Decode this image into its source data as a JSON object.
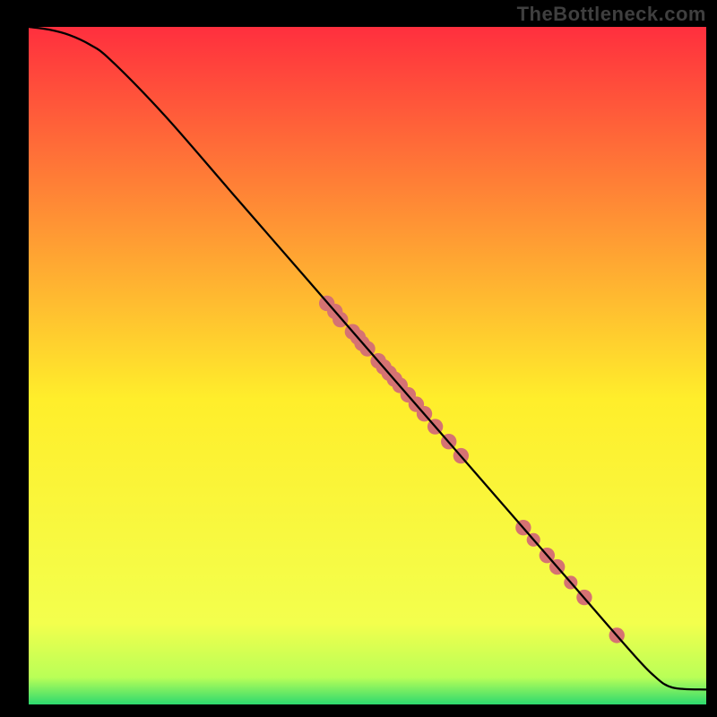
{
  "watermark": "TheBottleneck.com",
  "chart_data": {
    "type": "line",
    "title": "",
    "xlabel": "",
    "ylabel": "",
    "xlim": [
      0,
      100
    ],
    "ylim": [
      0,
      100
    ],
    "series": [
      {
        "name": "curve",
        "x": [
          0,
          3,
          6,
          9,
          12,
          20,
          30,
          40,
          50,
          60,
          70,
          80,
          88,
          92,
          95,
          100
        ],
        "y": [
          100,
          99.6,
          98.8,
          97.4,
          95.2,
          87,
          75.5,
          64,
          52.5,
          41,
          29.5,
          18,
          8.8,
          4.5,
          2.5,
          2.2
        ]
      }
    ],
    "markers": [
      {
        "x": 44.0,
        "y": 59.2,
        "r": 1.15
      },
      {
        "x": 45.2,
        "y": 58.0,
        "r": 1.15
      },
      {
        "x": 46.0,
        "y": 56.8,
        "r": 1.15
      },
      {
        "x": 47.8,
        "y": 55.0,
        "r": 1.15
      },
      {
        "x": 48.6,
        "y": 54.2,
        "r": 1.15
      },
      {
        "x": 49.2,
        "y": 53.3,
        "r": 1.15
      },
      {
        "x": 50.0,
        "y": 52.5,
        "r": 1.15
      },
      {
        "x": 51.6,
        "y": 50.7,
        "r": 1.15
      },
      {
        "x": 52.4,
        "y": 49.8,
        "r": 1.15
      },
      {
        "x": 53.2,
        "y": 48.9,
        "r": 1.15
      },
      {
        "x": 54.0,
        "y": 48.0,
        "r": 1.15
      },
      {
        "x": 54.8,
        "y": 47.1,
        "r": 1.15
      },
      {
        "x": 56.0,
        "y": 45.7,
        "r": 1.15
      },
      {
        "x": 57.2,
        "y": 44.3,
        "r": 1.15
      },
      {
        "x": 58.4,
        "y": 42.9,
        "r": 1.15
      },
      {
        "x": 60.0,
        "y": 41.0,
        "r": 1.15
      },
      {
        "x": 62.0,
        "y": 38.8,
        "r": 1.15
      },
      {
        "x": 63.8,
        "y": 36.7,
        "r": 1.15
      },
      {
        "x": 73.0,
        "y": 26.1,
        "r": 1.15
      },
      {
        "x": 74.5,
        "y": 24.3,
        "r": 1.0
      },
      {
        "x": 76.5,
        "y": 22.0,
        "r": 1.15
      },
      {
        "x": 78.0,
        "y": 20.3,
        "r": 1.15
      },
      {
        "x": 80.0,
        "y": 18.0,
        "r": 1.0
      },
      {
        "x": 82.0,
        "y": 15.8,
        "r": 1.15
      },
      {
        "x": 86.8,
        "y": 10.2,
        "r": 1.15
      }
    ],
    "gradient_top": "#ff2f3e",
    "gradient_mid_a": "#ffee2b",
    "gradient_mid_b": "#f3ff4d",
    "gradient_bottom": "#2dd96f",
    "curve_color": "#000000",
    "marker_color": "#d57272"
  }
}
